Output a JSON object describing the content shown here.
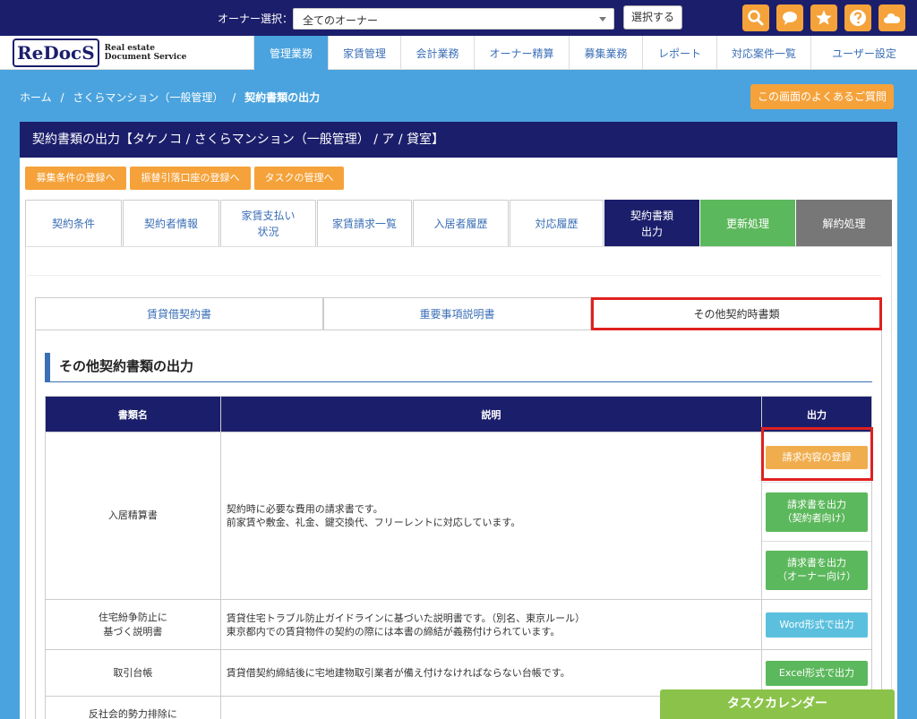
{
  "topbar": {
    "owner_label": "オーナー選択：",
    "owner_selected": "全てのオーナー",
    "select_button": "選択する",
    "icons": [
      "search-icon",
      "chat-icon",
      "star-icon",
      "help-icon",
      "cloud-icon"
    ],
    "icon_color": "#f5a23a"
  },
  "logo": {
    "re": "Re",
    "docs": "DocS",
    "line1": "Real estate",
    "line2": "Document Service"
  },
  "nav": [
    "管理業務",
    "家賃管理",
    "会計業務",
    "オーナー精算",
    "募集業務",
    "レポート",
    "対応案件一覧",
    "ユーザー設定"
  ],
  "breadcrumb": {
    "home": "ホーム",
    "property": "さくらマンション（一般管理）",
    "current": "契約書類の出力",
    "sep": "/"
  },
  "faq_button": "この画面のよくあるご質問",
  "panel_title": "契約書類の出力【タケノコ / さくらマンション（一般管理） / ア / 貸室】",
  "sub_buttons": [
    "募集条件の登録へ",
    "振替引落口座の登録へ",
    "タスクの管理へ"
  ],
  "tabs": [
    "契約条件",
    "契約者情報",
    "家賃支払い\n状況",
    "家賃請求一覧",
    "入居者履歴",
    "対応履歴",
    "契約書類\n出力",
    "更新処理",
    "解約処理"
  ],
  "subtabs": [
    "賃貸借契約書",
    "重要事項説明書",
    "その他契約時書類"
  ],
  "section_title": "その他契約書類の出力",
  "table": {
    "headers": [
      "書類名",
      "説明",
      "出力"
    ],
    "rows": [
      {
        "name": "入居精算書",
        "desc": "契約時に必要な費用の請求書です。\n前家賃や敷金、礼金、鍵交換代、フリーレントに対応しています。",
        "buttons": [
          "請求内容の登録",
          "請求書を出力\n（契約者向け）",
          "請求書を出力\n（オーナー向け）"
        ]
      },
      {
        "name": "住宅紛争防止に\n基づく説明書",
        "desc": "賃貸住宅トラブル防止ガイドラインに基づいた説明書です。（別名、東京ルール）\n東京都内での賃貸物件の契約の際には本書の締結が義務付けられています。",
        "buttons": [
          "Word形式で出力"
        ]
      },
      {
        "name": "取引台帳",
        "desc": "賃貸借契約締結後に宅地建物取引業者が備え付けなければならない台帳です。",
        "buttons": [
          "Excel形式で出力"
        ]
      },
      {
        "name": "反社会的勢力排除に",
        "desc": "",
        "buttons": []
      }
    ]
  },
  "task_calendar": "タスクカレンダー"
}
